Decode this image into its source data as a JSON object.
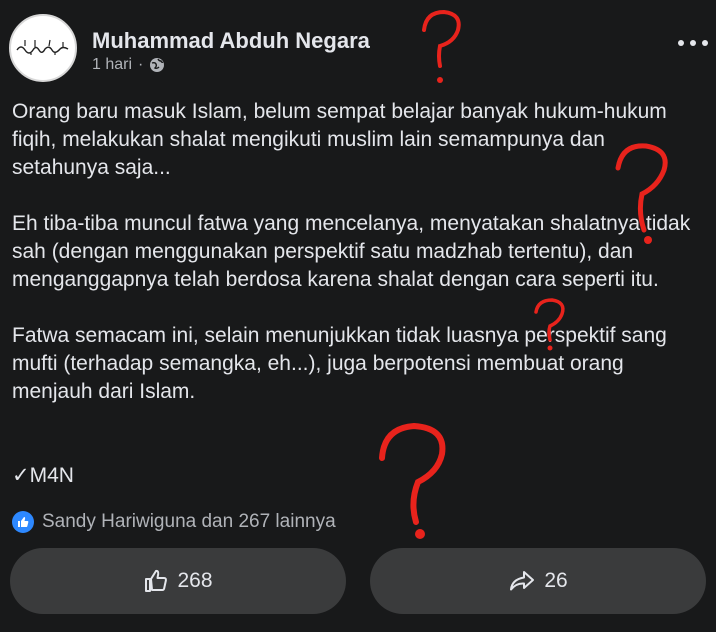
{
  "post": {
    "author": "Muhammad Abduh Negara",
    "avatar_text": "Muhammad Abduh Negara",
    "time": "1 hari",
    "separator": "·",
    "privacy_icon": "globe-icon",
    "paragraphs": [
      "Orang baru masuk Islam, belum sempat belajar banyak hukum-hukum fiqih, melakukan shalat mengikuti muslim lain semampunya dan setahunya saja...",
      "Eh tiba-tiba muncul fatwa yang mencelanya, menyatakan shalatnya tidak sah (dengan menggunakan perspektif satu madzhab tertentu), dan menganggapnya telah berdosa karena shalat dengan cara seperti itu.",
      "Fatwa semacam ini, selain menunjukkan tidak luasnya perspektif sang mufti (terhadap semangka, eh...), juga berpotensi membuat orang menjauh dari Islam."
    ],
    "signature": "✓M4N"
  },
  "reactions": {
    "summary": "Sandy Hariwiguna dan 267 lainnya"
  },
  "actions": {
    "like_count": "268",
    "share_count": "26"
  },
  "annotation": {
    "mark": "?",
    "color": "#e8231c"
  },
  "colors": {
    "background": "#18191a",
    "button": "#3a3b3c",
    "text": "#e4e6eb",
    "secondary": "#b0b3b8",
    "like_blue": "#2d88ff"
  }
}
